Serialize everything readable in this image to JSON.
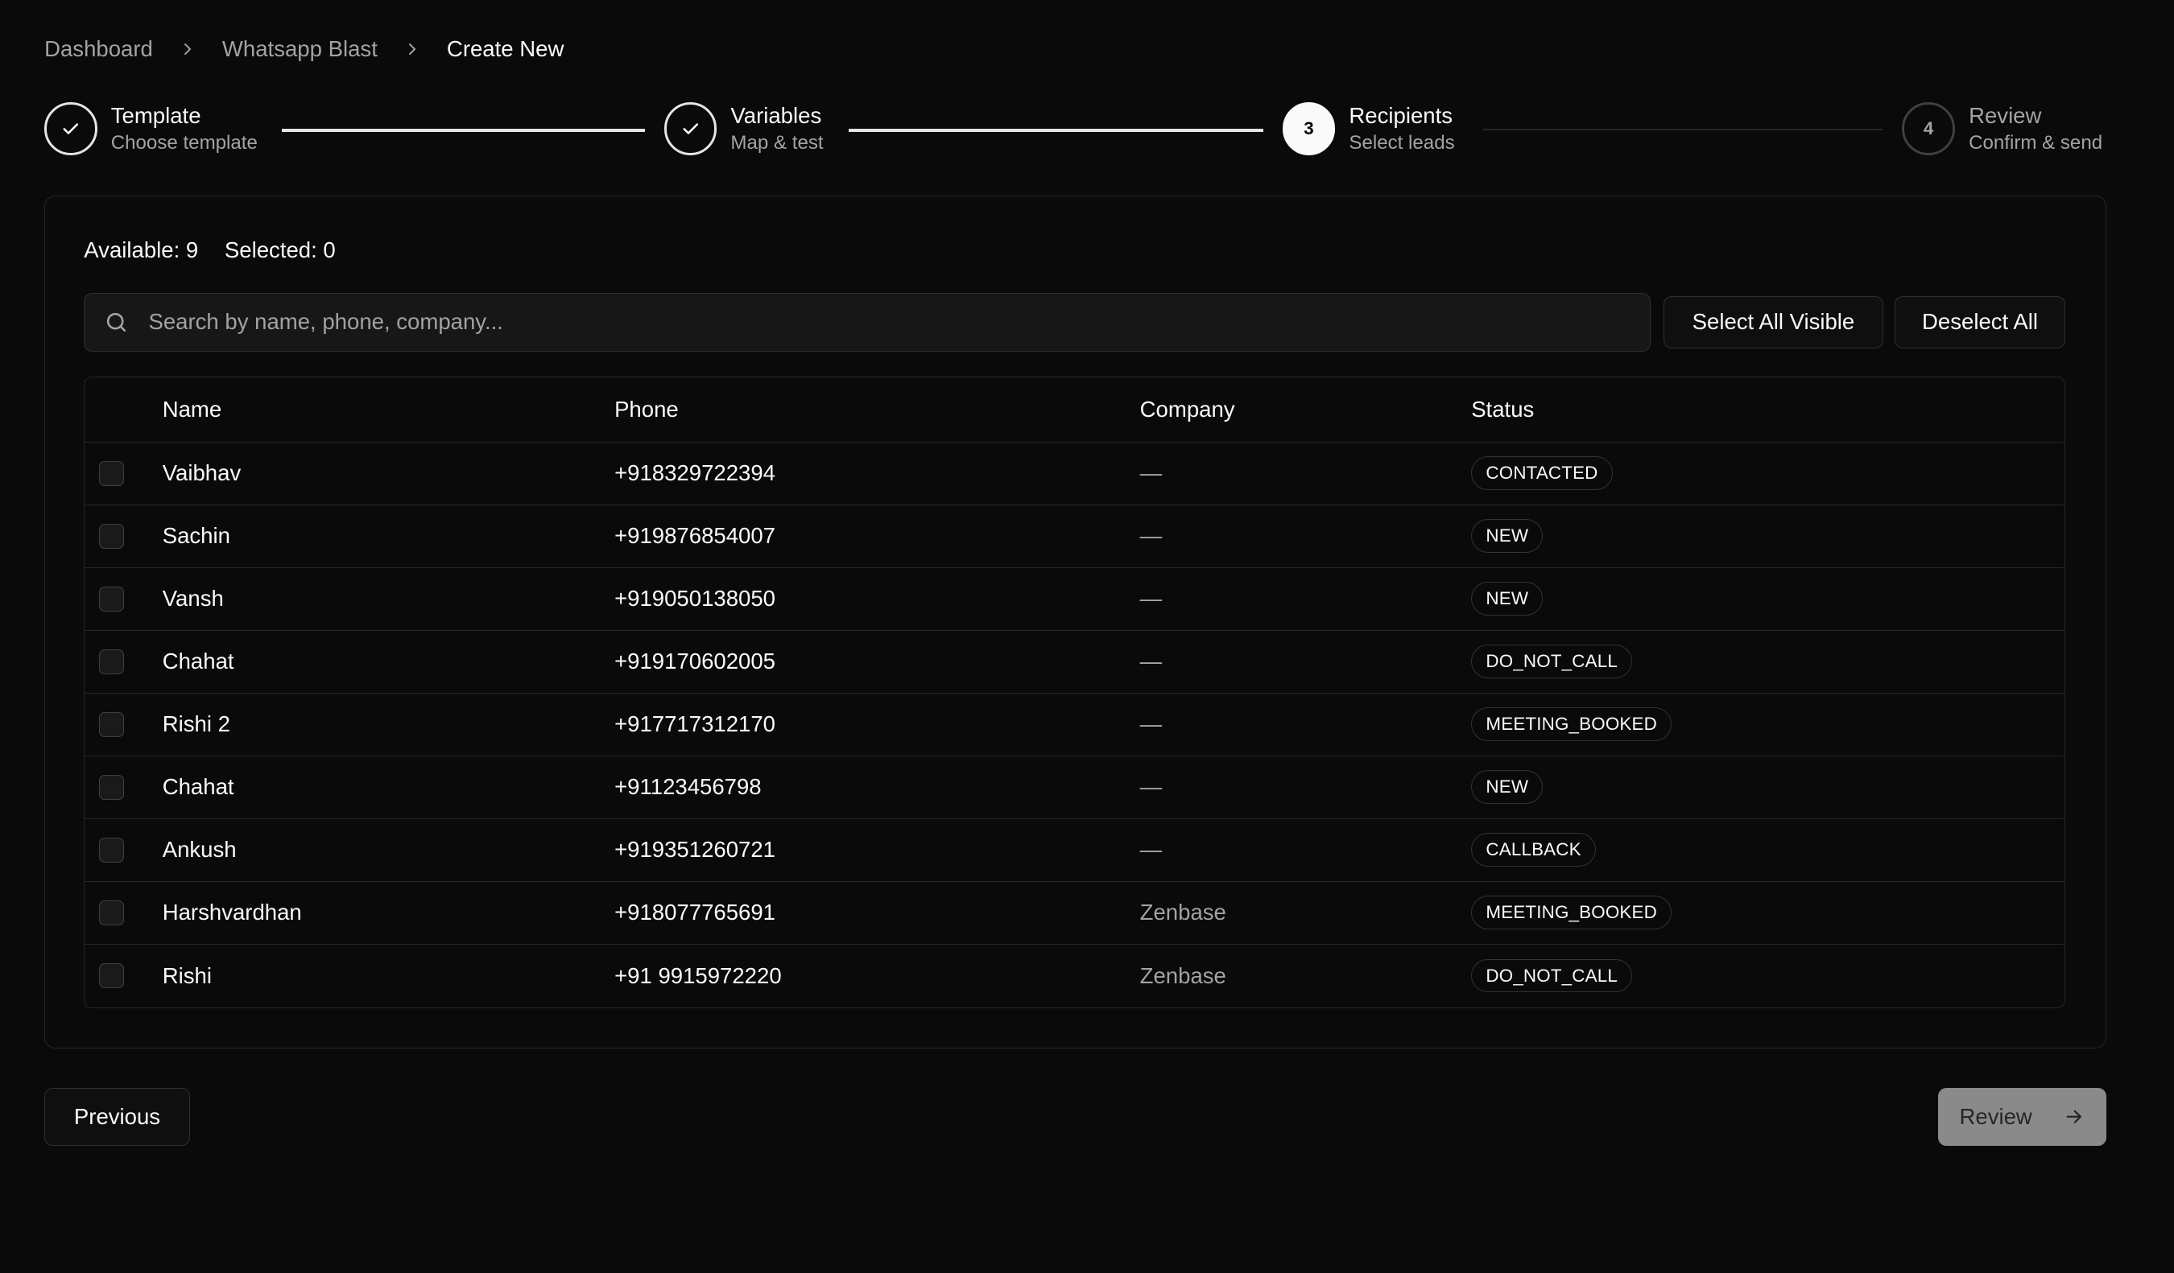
{
  "breadcrumb": [
    "Dashboard",
    "Whatsapp Blast",
    "Create New"
  ],
  "steps": [
    {
      "number": "1",
      "title": "Template",
      "subtitle": "Choose template",
      "state": "done"
    },
    {
      "number": "2",
      "title": "Variables",
      "subtitle": "Map & test",
      "state": "done"
    },
    {
      "number": "3",
      "title": "Recipients",
      "subtitle": "Select leads",
      "state": "active"
    },
    {
      "number": "4",
      "title": "Review",
      "subtitle": "Confirm & send",
      "state": "pending"
    }
  ],
  "counts": {
    "available": "Available: 9",
    "selected": "Selected: 0"
  },
  "search": {
    "placeholder": "Search by name, phone, company..."
  },
  "actions": {
    "select_all": "Select All Visible",
    "deselect_all": "Deselect All"
  },
  "table": {
    "headers": {
      "name": "Name",
      "phone": "Phone",
      "company": "Company",
      "status": "Status"
    },
    "rows": [
      {
        "name": "Vaibhav",
        "phone": "+918329722394",
        "company": "—",
        "status": "CONTACTED"
      },
      {
        "name": "Sachin",
        "phone": "+919876854007",
        "company": "—",
        "status": "NEW"
      },
      {
        "name": "Vansh",
        "phone": "+919050138050",
        "company": "—",
        "status": "NEW"
      },
      {
        "name": "Chahat",
        "phone": "+919170602005",
        "company": "—",
        "status": "DO_NOT_CALL"
      },
      {
        "name": "Rishi 2",
        "phone": "+917717312170",
        "company": "—",
        "status": "MEETING_BOOKED"
      },
      {
        "name": "Chahat",
        "phone": "+91123456798",
        "company": "—",
        "status": "NEW"
      },
      {
        "name": "Ankush",
        "phone": "+919351260721",
        "company": "—",
        "status": "CALLBACK"
      },
      {
        "name": "Harshvardhan",
        "phone": "+918077765691",
        "company": "Zenbase",
        "status": "MEETING_BOOKED"
      },
      {
        "name": "Rishi",
        "phone": "+91 9915972220",
        "company": "Zenbase",
        "status": "DO_NOT_CALL"
      }
    ]
  },
  "footer": {
    "previous": "Previous",
    "review": "Review"
  }
}
